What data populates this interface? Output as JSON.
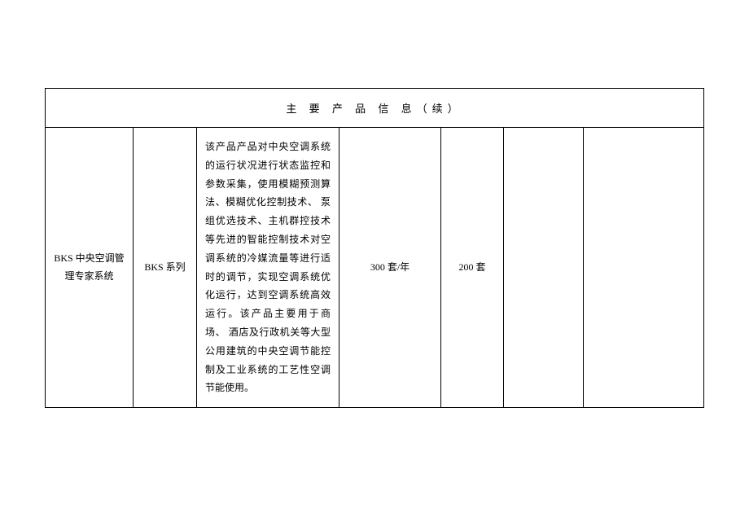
{
  "table": {
    "title": "主 要 产 品 信 息（续）",
    "rows": [
      {
        "col1": "BKS 中央空调管理专家系统",
        "col2": "BKS 系列",
        "col3": "该产品产品对中央空调系统的运行状况进行状态监控和参数采集，使用模糊预测算法、模糊优化控制技术、 泵组优选技术、主机群控技术等先进的智能控制技术对空调系统的冷媒流量等进行适时的调节，实现空调系统优化运行，达到空调系统高效运行。该产品主要用于商场、 酒店及行政机关等大型公用建筑的中央空调节能控制及工业系统的工艺性空调节能使用。",
        "col4": "300 套/年",
        "col5": "200 套",
        "col6": "",
        "col7": ""
      }
    ]
  }
}
